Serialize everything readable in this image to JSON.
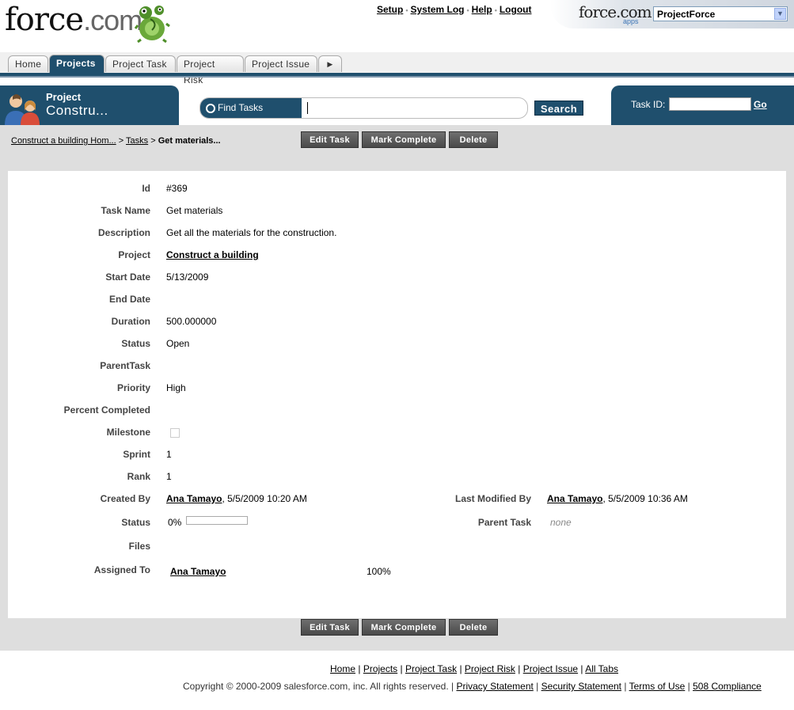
{
  "header": {
    "logo_word": "force",
    "logo_ext": ".com",
    "links": [
      "Setup",
      "System Log",
      "Help",
      "Logout"
    ],
    "app_logo": "force.com",
    "app_logo_sub": "apps",
    "app_select": "ProjectForce"
  },
  "tabs": [
    "Home",
    "Projects",
    "Project Task",
    "Project Risk",
    "Project Issue"
  ],
  "banner": {
    "label": "Project",
    "name": "Constru...",
    "find_label": "Find Tasks",
    "search_button": "Search",
    "taskid_label": "Task ID:",
    "go_label": "Go"
  },
  "breadcrumb": {
    "project": "Construct a building Hom...",
    "tasks": "Tasks",
    "current": "Get materials...",
    "sep": ">"
  },
  "buttons": {
    "edit": "Edit Task",
    "complete": "Mark Complete",
    "delete": "Delete"
  },
  "fields": {
    "id_label": "Id",
    "id": "#369",
    "taskname_label": "Task Name",
    "taskname": "Get materials",
    "description_label": "Description",
    "description": "Get all the materials for the construction.",
    "project_label": "Project",
    "project": "Construct a building",
    "startdate_label": "Start Date",
    "startdate": "5/13/2009",
    "enddate_label": "End Date",
    "enddate": "",
    "duration_label": "Duration",
    "duration": "500.000000",
    "status_label": "Status",
    "status": "Open",
    "parenttask_label": "ParentTask",
    "parenttask": "",
    "priority_label": "Priority",
    "priority": "High",
    "percent_label": "Percent Completed",
    "percent": "",
    "milestone_label": "Milestone",
    "sprint_label": "Sprint",
    "sprint": "1",
    "rank_label": "Rank",
    "rank": "1",
    "createdby_label": "Created By",
    "createdby_user": "Ana Tamayo",
    "createdby_date": ", 5/5/2009 10:20 AM",
    "lastmod_label": "Last Modified By",
    "lastmod_user": "Ana Tamayo",
    "lastmod_date": ", 5/5/2009 10:36 AM",
    "status2_label": "Status",
    "status2_pct": "0%",
    "status2_progress": 0,
    "parent2_label": "Parent Task",
    "parent2": "none",
    "files_label": "Files",
    "assigned_label": "Assigned To",
    "assigned_user": "Ana Tamayo",
    "assigned_pct": "100%"
  },
  "footer": {
    "links": [
      "Home",
      "Projects",
      "Project Task",
      "Project Risk",
      "Project Issue",
      "All Tabs"
    ],
    "copyright": "Copyright © 2000-2009 salesforce.com, inc. All rights reserved. |",
    "legal": [
      "Privacy Statement",
      "Security Statement",
      "Terms of Use",
      "508 Compliance"
    ]
  }
}
